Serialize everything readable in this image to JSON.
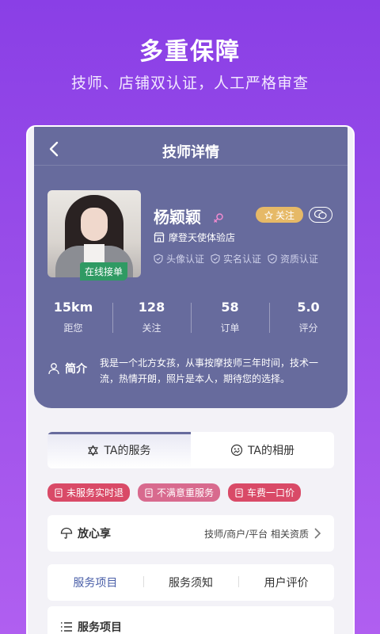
{
  "promo": {
    "title": "多重保障",
    "subtitle": "技师、店铺双认证，人工严格审查"
  },
  "nav": {
    "title": "技师详情"
  },
  "profile": {
    "name": "杨颖颖",
    "online_badge": "在线接单",
    "follow_label": "关注",
    "shop": "摩登天使体验店",
    "certs": [
      "头像认证",
      "实名认证",
      "资质认证"
    ]
  },
  "stats": [
    {
      "value": "15km",
      "label": "距您"
    },
    {
      "value": "128",
      "label": "关注"
    },
    {
      "value": "58",
      "label": "订单"
    },
    {
      "value": "5.0",
      "label": "评分"
    }
  ],
  "intro": {
    "label": "简介",
    "text": "我是一个北方女孩，从事按摩技师三年时间，技术一流，热情开朗，照片是本人，期待您的选择。"
  },
  "tabs": [
    {
      "label": "TA的服务",
      "icon": "star-of-david-icon"
    },
    {
      "label": "TA的相册",
      "icon": "photo-face-icon"
    }
  ],
  "tags": [
    "未服务实时退",
    "不满意重服务",
    "车费一口价"
  ],
  "assurance": {
    "label": "放心享",
    "desc": "技师/商户/平台 相关资质"
  },
  "subtabs": [
    "服务项目",
    "服务须知",
    "用户评价"
  ],
  "section": {
    "title": "服务项目"
  },
  "colors": {
    "header_bg": "#676b9d",
    "follow_bg": "#e6b967",
    "tag_bg": "#d94a67",
    "online_bg": "#2f9a63"
  }
}
